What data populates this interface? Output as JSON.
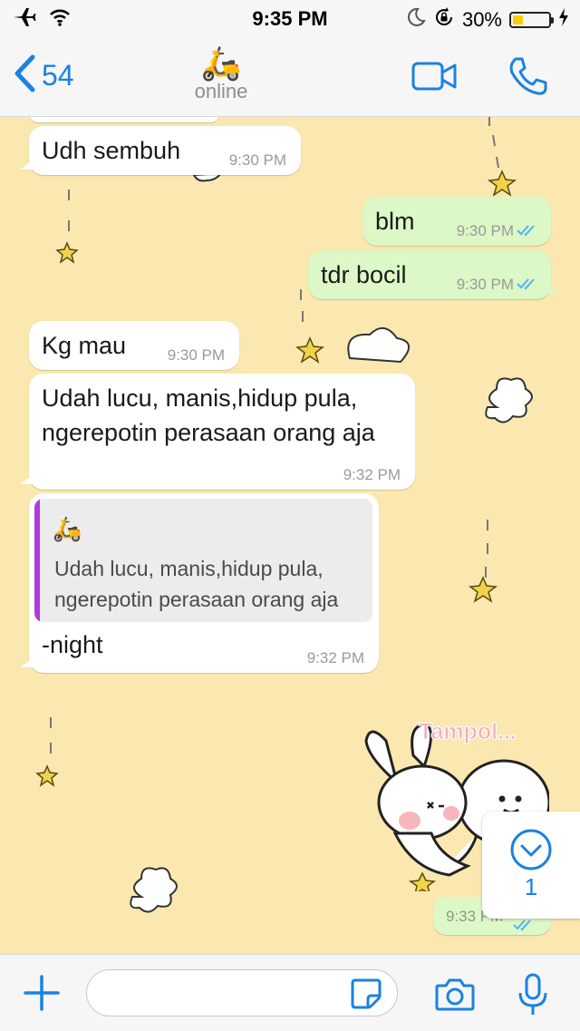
{
  "status_bar": {
    "time": "9:35 PM",
    "battery": "30%",
    "battery_level": 0.3,
    "icons": [
      "airplane-icon",
      "wifi-icon",
      "moon-icon",
      "rotation-lock-icon",
      "battery-icon",
      "charging-icon"
    ]
  },
  "header": {
    "back_count": "54",
    "contact_emoji": "🛵",
    "contact_status": "online",
    "icons": [
      "back-chevron-icon",
      "video-call-icon",
      "phone-call-icon"
    ]
  },
  "messages": [
    {
      "dir": "in",
      "text": "Udh sembuh",
      "time": "9:30 PM"
    },
    {
      "dir": "out",
      "text": "blm",
      "time": "9:30 PM",
      "read": true
    },
    {
      "dir": "out",
      "text": "tdr bocil",
      "time": "9:30 PM",
      "read": true
    },
    {
      "dir": "in",
      "text": "Kg mau",
      "time": "9:30 PM"
    },
    {
      "dir": "in",
      "lines": [
        "Udah lucu, manis,hidup pula,",
        "ngerepotin perasaan orang aja"
      ],
      "time": "9:32 PM"
    },
    {
      "dir": "in",
      "quote": {
        "author": "🛵",
        "lines": [
          "Udah lucu, manis,hidup pula,",
          "ngerepotin perasaan orang aja"
        ]
      },
      "text": "-night",
      "time": "9:32 PM"
    },
    {
      "dir": "out",
      "type": "sticker",
      "sticker_text": "Tampol...",
      "time": "9:33 PM",
      "read": true
    }
  ],
  "scroll_button": {
    "unread_count": "1"
  },
  "input_bar": {
    "placeholder": "",
    "icons": [
      "plus-icon",
      "sticker-icon",
      "camera-icon",
      "microphone-icon"
    ]
  },
  "colors": {
    "accent": "#1a82e2",
    "outgoing_bubble": "#dcf8c6",
    "incoming_bubble": "#ffffff",
    "wallpaper": "#fbe8b0",
    "read_ticks": "#4fb3f6",
    "quote_bar": "#b23ad8",
    "battery": "#ffcc00"
  }
}
